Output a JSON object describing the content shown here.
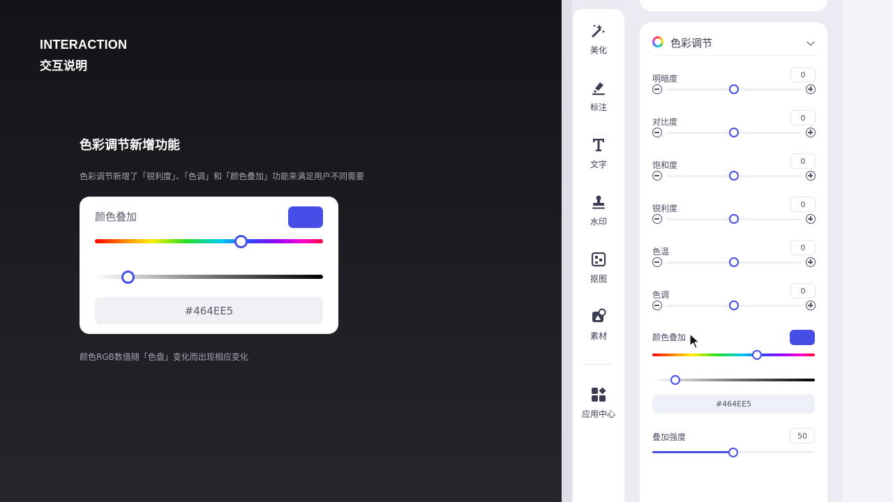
{
  "intro": {
    "heading_en": "INTERACTION",
    "heading_cn": "交互说明",
    "feature_title": "色彩调节新增功能",
    "feature_desc": "色彩调节新增了「锐利度」、「色调」和「颜色叠加」功能来满足用户不同需要",
    "feature_footnote": "颜色RGB数值随「色盘」变化而出现相应变化"
  },
  "demo_card": {
    "label": "颜色叠加",
    "swatch_color": "#464EE5",
    "hex_value": "#464EE5",
    "hue_position": 0.64,
    "lightness_position": 0.14
  },
  "toolbar": {
    "items": [
      {
        "label": "美化",
        "icon": "magic-wand-icon"
      },
      {
        "label": "标注",
        "icon": "marker-icon"
      },
      {
        "label": "文字",
        "icon": "text-icon"
      },
      {
        "label": "水印",
        "icon": "stamp-icon"
      },
      {
        "label": "抠图",
        "icon": "cutout-icon"
      },
      {
        "label": "素材",
        "icon": "material-icon"
      },
      {
        "label": "应用中心",
        "icon": "app-center-icon"
      }
    ]
  },
  "panel": {
    "title": "色彩调节",
    "accent_color": "#464EE5",
    "adjustments": [
      {
        "label": "明暗度",
        "value": "0",
        "position": 0.5
      },
      {
        "label": "对比度",
        "value": "0",
        "position": 0.5
      },
      {
        "label": "饱和度",
        "value": "0",
        "position": 0.5
      },
      {
        "label": "锐利度",
        "value": "0",
        "position": 0.5
      },
      {
        "label": "色温",
        "value": "0",
        "position": 0.5
      },
      {
        "label": "色调",
        "value": "0",
        "position": 0.5
      }
    ],
    "overlay": {
      "label": "颜色叠加",
      "swatch_color": "#464EE5",
      "hex_value": "#464EE5",
      "hue_position": 0.64,
      "lightness_position": 0.14
    },
    "intensity": {
      "label": "叠加强度",
      "value": "50",
      "fraction": 0.5
    }
  }
}
